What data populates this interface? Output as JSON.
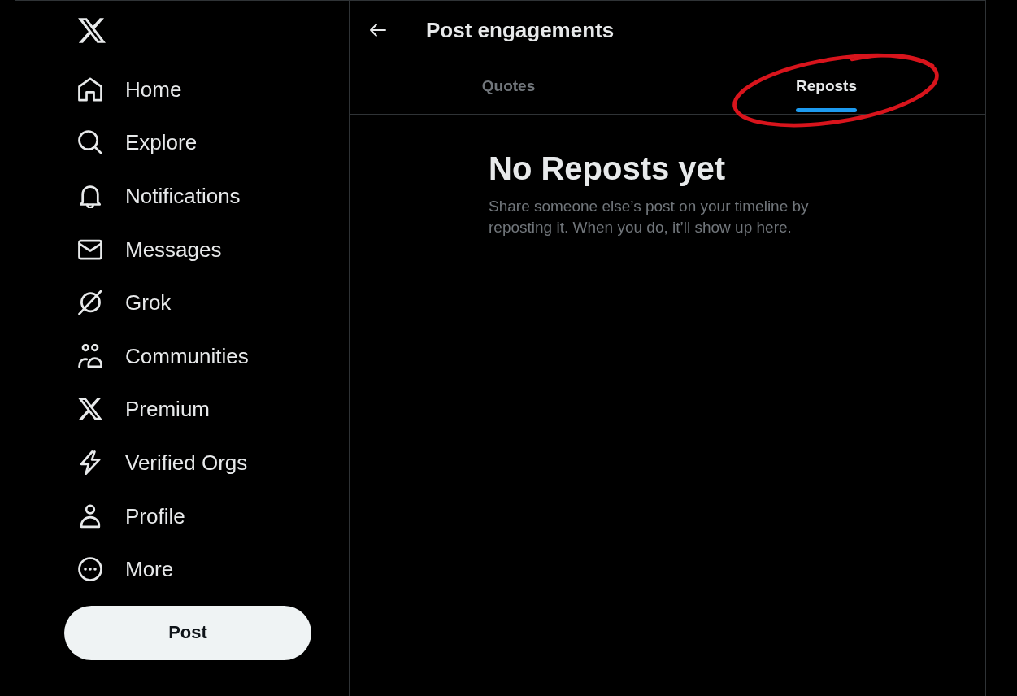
{
  "sidebar": {
    "items": [
      {
        "label": "Home",
        "selected": false
      },
      {
        "label": "Explore",
        "selected": false
      },
      {
        "label": "Notifications",
        "selected": false
      },
      {
        "label": "Messages",
        "selected": false
      },
      {
        "label": "Grok",
        "selected": false
      },
      {
        "label": "Communities",
        "selected": false
      },
      {
        "label": "Premium",
        "selected": false
      },
      {
        "label": "Verified Orgs",
        "selected": false
      },
      {
        "label": "Profile",
        "selected": false
      },
      {
        "label": "More",
        "selected": false
      }
    ],
    "post_button": {
      "label": "Post"
    }
  },
  "header": {
    "title": "Post engagements"
  },
  "tabs": [
    {
      "label": "Quotes",
      "selected": false,
      "circled": false
    },
    {
      "label": "Reposts",
      "selected": true,
      "circled": true
    }
  ],
  "empty_state": {
    "title": "No Reposts yet",
    "message": "Share someone else’s post on your timeline by reposting it. When you do, it’ll show up here."
  }
}
